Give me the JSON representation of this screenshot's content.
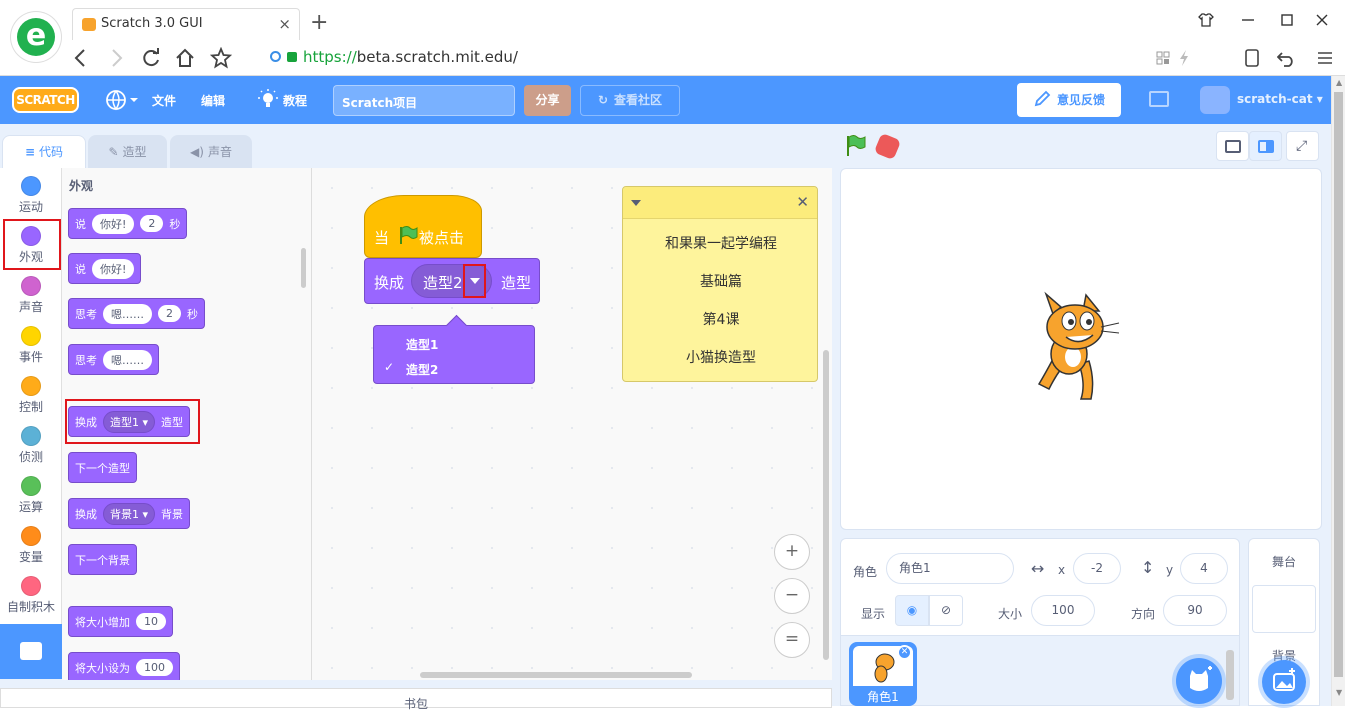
{
  "browser": {
    "tab_title": "Scratch 3.0 GUI",
    "tab_close": "×",
    "new_tab": "+",
    "url_scheme": "https://",
    "url_host": "beta.scratch.",
    "url_domain": "mit.edu",
    "url_path": "/"
  },
  "menubar": {
    "logo": "SCRATCH",
    "file": "文件",
    "edit": "编辑",
    "tutorials": "教程",
    "project_title": "Scratch项目",
    "share": "分享",
    "see_community": "查看社区",
    "feedback": "意见反馈",
    "username": "scratch-cat"
  },
  "editor_tabs": {
    "code": "代码",
    "costumes": "造型",
    "sounds": "声音"
  },
  "categories": [
    {
      "label": "运动",
      "color": "#4c97ff"
    },
    {
      "label": "外观",
      "color": "#9966ff"
    },
    {
      "label": "声音",
      "color": "#cf63cf"
    },
    {
      "label": "事件",
      "color": "#ffd500"
    },
    {
      "label": "控制",
      "color": "#ffab19"
    },
    {
      "label": "侦测",
      "color": "#5cb1d6"
    },
    {
      "label": "运算",
      "color": "#59c059"
    },
    {
      "label": "变量",
      "color": "#ff8c1a"
    },
    {
      "label": "自制积木",
      "color": "#ff6680"
    }
  ],
  "palette": {
    "title": "外观",
    "say_for": {
      "a": "说",
      "b": "你好!",
      "c": "2",
      "d": "秒"
    },
    "say": {
      "a": "说",
      "b": "你好!"
    },
    "think_for": {
      "a": "思考",
      "b": "嗯……",
      "c": "2",
      "d": "秒"
    },
    "think": {
      "a": "思考",
      "b": "嗯……"
    },
    "switch_costume": {
      "a": "换成",
      "b": "造型1",
      "c": "造型"
    },
    "next_costume": "下一个造型",
    "switch_backdrop": {
      "a": "换成",
      "b": "背景1",
      "c": "背景"
    },
    "next_backdrop": "下一个背景",
    "change_size": {
      "a": "将大小增加",
      "b": "10"
    },
    "set_size": {
      "a": "将大小设为",
      "b": "100"
    }
  },
  "script": {
    "hat_a": "当",
    "hat_b": "被点击",
    "switch_a": "换成",
    "switch_dd": "造型2",
    "switch_b": "造型",
    "menu_options": [
      "造型1",
      "造型2"
    ],
    "checkmark": "✓"
  },
  "note": {
    "lines": [
      "和果果一起学编程",
      "基础篇",
      "第4课",
      "小猫换造型"
    ],
    "close": "✕"
  },
  "zoom": {
    "in": "+",
    "out": "−",
    "reset": "="
  },
  "backpack": "书包",
  "sprite_info": {
    "sprite_label": "角色",
    "sprite_name": "角色1",
    "x_label": "x",
    "x_value": "-2",
    "y_label": "y",
    "y_value": "4",
    "show_label": "显示",
    "size_label": "大小",
    "size_value": "100",
    "direction_label": "方向",
    "direction_value": "90"
  },
  "sprite_list": {
    "name": "角色1"
  },
  "stage_panel": {
    "title": "舞台",
    "backdrops": "背景"
  }
}
